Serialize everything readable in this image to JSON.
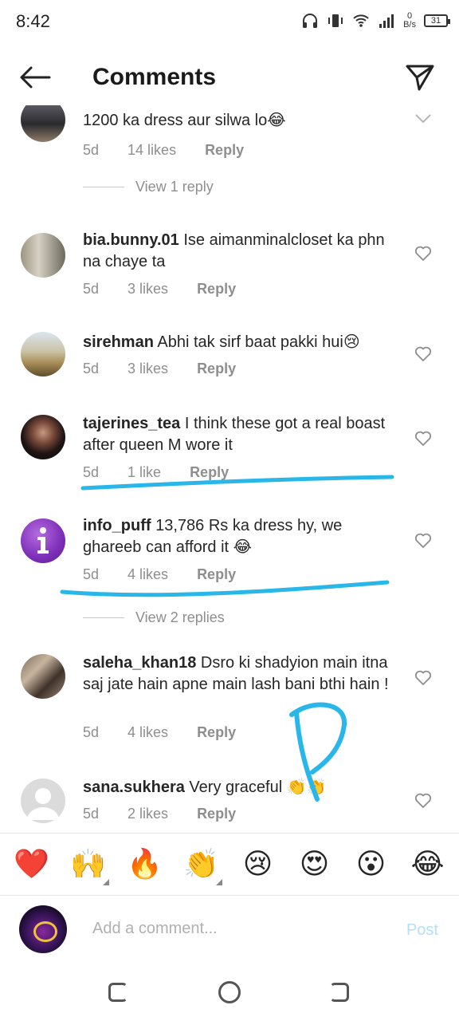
{
  "status": {
    "time": "8:42",
    "net_speed_value": "0",
    "net_speed_unit": "B/s",
    "battery": "31"
  },
  "header": {
    "title": "Comments"
  },
  "comments": [
    {
      "username": "",
      "text": "1200 ka dress aur silwa lo😂",
      "age": "5d",
      "likes": "14 likes",
      "reply": "Reply",
      "view_replies": "View 1 reply"
    },
    {
      "username": "bia.bunny.01",
      "text": "Ise aimanminalcloset ka phn na chaye ta",
      "age": "5d",
      "likes": "3 likes",
      "reply": "Reply"
    },
    {
      "username": "sirehman",
      "text": "Abhi tak sirf baat pakki hui😢",
      "age": "5d",
      "likes": "3 likes",
      "reply": "Reply"
    },
    {
      "username": "tajerines_tea",
      "text": "I think these got a real boast after queen M wore it",
      "age": "5d",
      "likes": "1 like",
      "reply": "Reply"
    },
    {
      "username": "info_puff",
      "text": "13,786 Rs ka dress hy, we ghareeb can afford it 😂",
      "age": "5d",
      "likes": "4 likes",
      "reply": "Reply",
      "view_replies": "View 2 replies"
    },
    {
      "username": "saleha_khan18",
      "text": "Dsro ki shadyion main itna saj jate hain apne main lash bani bthi hain !",
      "age": "5d",
      "likes": "4 likes",
      "reply": "Reply"
    },
    {
      "username": "sana.sukhera",
      "text": "Very graceful 👏👏",
      "age": "5d",
      "likes": "2 likes",
      "reply": "Reply"
    }
  ],
  "emoji_bar": [
    "❤️",
    "🙌",
    "🔥",
    "👏",
    "😢",
    "😍",
    "😮",
    "😂"
  ],
  "composer": {
    "placeholder": "Add a comment...",
    "post_label": "Post"
  },
  "colors": {
    "scribble": "#29b6e8",
    "post_disabled": "#b2dffc",
    "muted_text": "#8e8e8e"
  }
}
